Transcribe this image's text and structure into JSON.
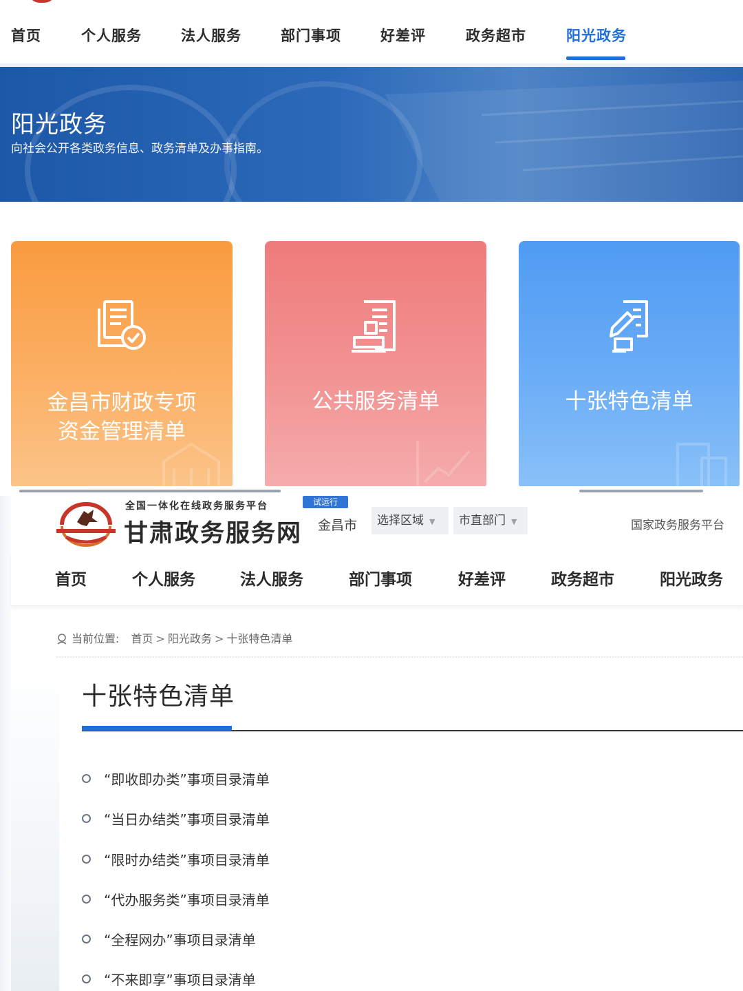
{
  "top_nav": {
    "items": [
      "首页",
      "个人服务",
      "法人服务",
      "部门事项",
      "好差评",
      "政务超市",
      "阳光政务"
    ],
    "active": "阳光政务"
  },
  "banner": {
    "title": "阳光政务",
    "subtitle": "向社会公开各类政务信息、政务清单及办事指南。"
  },
  "cards": [
    {
      "line1": "金昌市财政专项",
      "line2": "资金管理清单",
      "icon": "document-check-icon",
      "color": "#f99b3f"
    },
    {
      "line1": "公共服务清单",
      "line2": "",
      "icon": "document-stamp-icon",
      "color": "#ef7b7b"
    },
    {
      "line1": "十张特色清单",
      "line2": "",
      "icon": "document-edit-icon",
      "color": "#4f9bf3"
    }
  ],
  "header": {
    "slogan": "全国一体化在线政务服务平台",
    "trial_badge": "试运行",
    "site_name": "甘肃政务服务网",
    "city": "金昌市",
    "region_select": "选择区域",
    "dept_select": "市直部门",
    "national_link": "国家政务服务平台"
  },
  "nav": {
    "items": [
      "首页",
      "个人服务",
      "法人服务",
      "部门事项",
      "好差评",
      "政务超市",
      "阳光政务"
    ]
  },
  "breadcrumb": {
    "prefix": "当前位置:",
    "items": [
      "首页",
      "阳光政务",
      "十张特色清单"
    ]
  },
  "page": {
    "title": "十张特色清单",
    "lists": [
      "“即收即办类”事项目录清单",
      "“当日办结类”事项目录清单",
      "“限时办结类”事项目录清单",
      "“代办服务类”事项目录清单",
      "“全程网办”事项目录清单",
      "“不来即享”事项目录清单"
    ]
  },
  "colors": {
    "accent_blue": "#1f6fd8",
    "banner_blue": "#2c69b9",
    "text_dark": "#2b2b2b"
  }
}
